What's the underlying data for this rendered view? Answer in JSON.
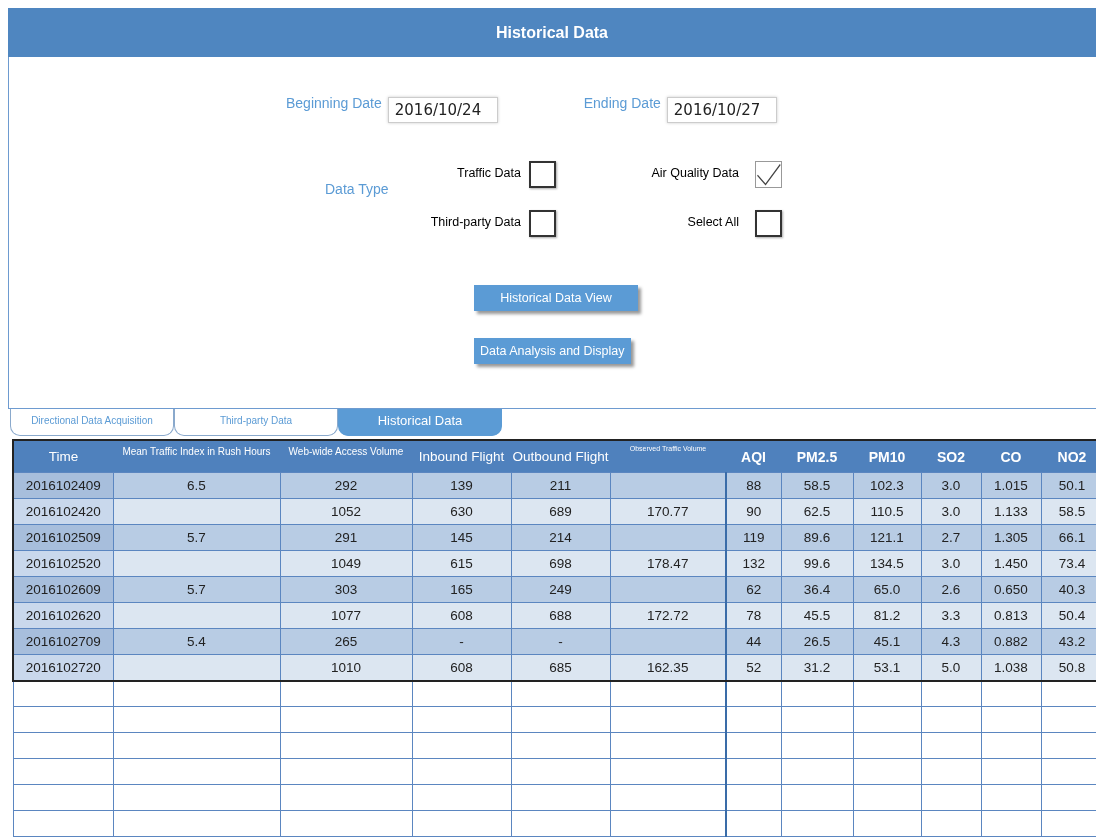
{
  "window": {
    "title": "Historical Data"
  },
  "dates": [
    {
      "label": "Beginning Date",
      "value": "2016/10/24"
    },
    {
      "label": "Ending Date",
      "value": "2016/10/27"
    }
  ],
  "data_type": {
    "label": "Data Type",
    "options": [
      {
        "label": "Traffic Data",
        "checked": false
      },
      {
        "label": "Air Quality Data",
        "checked": true
      },
      {
        "label": "Third-party Data",
        "checked": false
      },
      {
        "label": "Select All",
        "checked": false
      }
    ]
  },
  "buttons": [
    "Historical Data View",
    "Data Analysis and Display"
  ],
  "tabs": [
    {
      "label": "Directional Data Acquisition",
      "selected": false
    },
    {
      "label": "Third-party Data",
      "selected": false
    },
    {
      "label": "Historical Data",
      "selected": true
    }
  ],
  "table": {
    "columns": [
      {
        "label": "Time",
        "kind": "label"
      },
      {
        "label": "Mean Traffic Index in Rush Hours",
        "kind": "note"
      },
      {
        "label": "Web-wide Access Volume",
        "kind": "note"
      },
      {
        "label": "Inbound Flight",
        "kind": "label"
      },
      {
        "label": "Outbound Flight",
        "kind": "label"
      },
      {
        "label": "Observed Traffic Volume",
        "kind": "tiny"
      },
      {
        "label": "AQI",
        "kind": "metric"
      },
      {
        "label": "PM2.5",
        "kind": "metric"
      },
      {
        "label": "PM10",
        "kind": "metric"
      },
      {
        "label": "SO2",
        "kind": "metric"
      },
      {
        "label": "CO",
        "kind": "metric"
      },
      {
        "label": "NO2",
        "kind": "metric"
      }
    ],
    "rows": [
      [
        "2016102409",
        "6.5",
        "292",
        "139",
        "211",
        null,
        "88",
        "58.5",
        "102.3",
        "3.0",
        "1.015",
        "50.1"
      ],
      [
        "2016102420",
        null,
        "1052",
        "630",
        "689",
        "170.77",
        "90",
        "62.5",
        "110.5",
        "3.0",
        "1.133",
        "58.5"
      ],
      [
        "2016102509",
        "5.7",
        "291",
        "145",
        "214",
        null,
        "119",
        "89.6",
        "121.1",
        "2.7",
        "1.305",
        "66.1"
      ],
      [
        "2016102520",
        null,
        "1049",
        "615",
        "698",
        "178.47",
        "132",
        "99.6",
        "134.5",
        "3.0",
        "1.450",
        "73.4"
      ],
      [
        "2016102609",
        "5.7",
        "303",
        "165",
        "249",
        null,
        "62",
        "36.4",
        "65.0",
        "2.6",
        "0.650",
        "40.3"
      ],
      [
        "2016102620",
        null,
        "1077",
        "608",
        "688",
        "172.72",
        "78",
        "45.5",
        "81.2",
        "3.3",
        "0.813",
        "50.4"
      ],
      [
        "2016102709",
        "5.4",
        "265",
        "-",
        "-",
        null,
        "44",
        "26.5",
        "45.1",
        "4.3",
        "0.882",
        "43.2"
      ],
      [
        "2016102720",
        null,
        "1010",
        "608",
        "685",
        "162.35",
        "52",
        "31.2",
        "53.1",
        "5.0",
        "1.038",
        "50.8"
      ]
    ]
  }
}
